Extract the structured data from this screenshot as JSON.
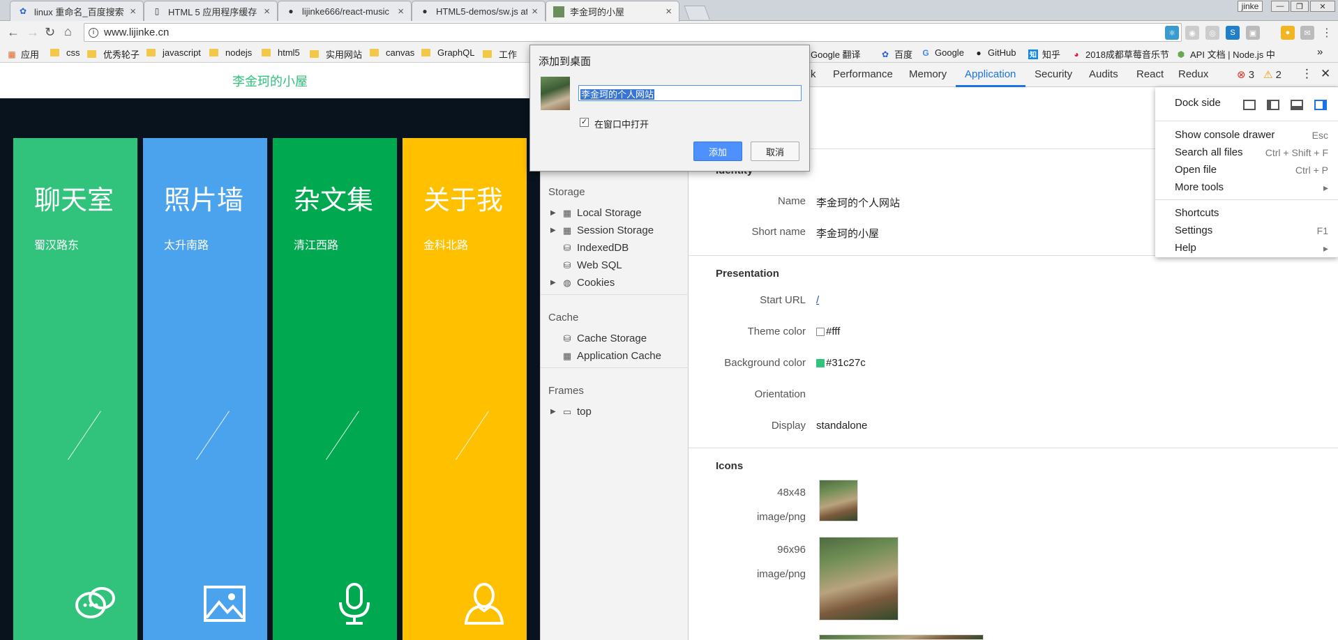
{
  "tabs": [
    {
      "title": "linux 重命名_百度搜索",
      "icon": "baidu-paw-icon"
    },
    {
      "title": "HTML 5 应用程序缓存",
      "icon": "page-icon"
    },
    {
      "title": "lijinke666/react-music",
      "icon": "github-icon"
    },
    {
      "title": "HTML5-demos/sw.js at",
      "icon": "github-icon"
    },
    {
      "title": "李金珂的小屋",
      "icon": "site-photo-icon"
    }
  ],
  "window": {
    "user": "jinke"
  },
  "toolbar": {
    "url": "www.lijinke.cn"
  },
  "bookmarks": {
    "apps": "应用",
    "items": [
      "css",
      "优秀轮子",
      "javascript",
      "nodejs",
      "html5",
      "实用网站",
      "canvas",
      "GraphQL",
      "工作"
    ],
    "links": [
      "Google 翻译",
      "百度",
      "Google",
      "GitHub",
      "知乎",
      "2018成都草莓音乐节",
      "API 文档 | Node.js 中"
    ],
    "more": "»"
  },
  "site": {
    "header_title": "李金珂的小屋",
    "cards": [
      {
        "title": "聊天室",
        "subtitle": "蜀汉路东",
        "color": "#31c27c",
        "icon": "chat-bubbles-icon"
      },
      {
        "title": "照片墙",
        "subtitle": "太升南路",
        "color": "#4aa3ec",
        "icon": "image-icon"
      },
      {
        "title": "杂文集",
        "subtitle": "清江西路",
        "color": "#00a94f",
        "icon": "microphone-icon"
      },
      {
        "title": "关于我",
        "subtitle": "金科北路",
        "color": "#ffc000",
        "icon": "user-icon"
      }
    ]
  },
  "devtools": {
    "tabs": [
      "k",
      "Performance",
      "Memory",
      "Application",
      "Security",
      "Audits",
      "React",
      "Redux"
    ],
    "active_tab": "Application",
    "errors": "3",
    "warnings": "2",
    "sidebar": {
      "storage_title": "Storage",
      "storage_items": [
        "Local Storage",
        "Session Storage",
        "IndexedDB",
        "Web SQL",
        "Cookies"
      ],
      "cache_title": "Cache",
      "cache_items": [
        "Cache Storage",
        "Application Cache"
      ],
      "frames_title": "Frames",
      "frames_items": [
        "top"
      ]
    },
    "manifest": {
      "identity_head": "Identity",
      "name_label": "Name",
      "name_value": "李金珂的个人网站",
      "short_label": "Short name",
      "short_value": "李金珂的小屋",
      "presentation_head": "Presentation",
      "start_url_label": "Start URL",
      "start_url_value": "/",
      "theme_label": "Theme color",
      "theme_value": "#fff",
      "bg_label": "Background color",
      "bg_value": "#31c27c",
      "orientation_label": "Orientation",
      "display_label": "Display",
      "display_value": "standalone",
      "icons_head": "Icons",
      "icon1_size": "48x48",
      "icon1_type": "image/png",
      "icon2_size": "96x96",
      "icon2_type": "image/png"
    },
    "menu": {
      "dock_side": "Dock side",
      "items": [
        {
          "label": "Show console drawer",
          "shortcut": "Esc"
        },
        {
          "label": "Search all files",
          "shortcut": "Ctrl + Shift + F"
        },
        {
          "label": "Open file",
          "shortcut": "Ctrl + P"
        },
        {
          "label": "More tools",
          "shortcut": "▸"
        },
        {
          "label": "Shortcuts",
          "shortcut": ""
        },
        {
          "label": "Settings",
          "shortcut": "F1"
        },
        {
          "label": "Help",
          "shortcut": "▸"
        }
      ]
    }
  },
  "dialog": {
    "title": "添加到桌面",
    "name_value": "李金珂的个人网站",
    "checkbox_label": "在窗口中打开",
    "add_label": "添加",
    "cancel_label": "取消"
  }
}
